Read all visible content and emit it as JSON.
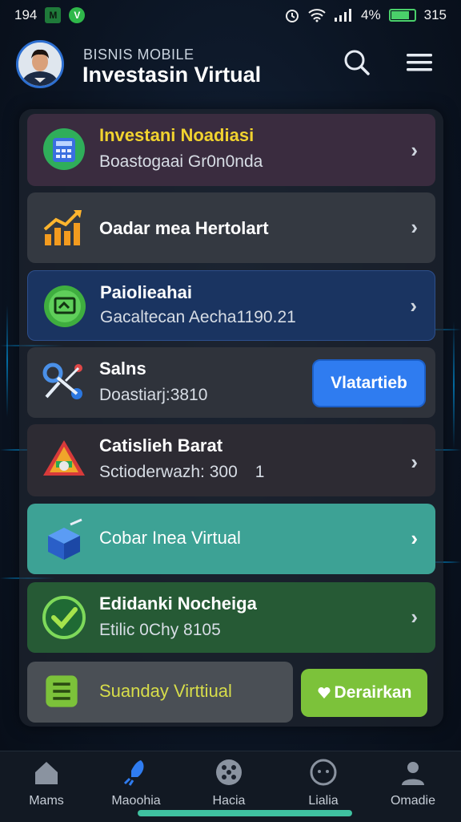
{
  "status_bar": {
    "time": "194",
    "wifi_signal": "4%",
    "battery_text": "315",
    "icons": [
      "m-icon",
      "vpn-icon",
      "alarm-icon",
      "wifi-icon",
      "signal-icon",
      "battery-icon"
    ]
  },
  "header": {
    "subtitle": "BISNIS MOBILE",
    "title": "Investasin Virtual"
  },
  "cards": [
    {
      "title": "Investani Noadiasi",
      "subtitle": "Boastogaai Gr0n0nda",
      "icon": "calculator-icon",
      "color": "#3a2c3f",
      "title_color": "#f1d32f"
    },
    {
      "title": "Oadar mea Hertolart",
      "subtitle": "",
      "icon": "chart-growth-icon",
      "color": "#343941"
    },
    {
      "title": "Paiolieahai",
      "subtitle": "Gacaltecan Aecha1190.21",
      "icon": "monitor-icon",
      "color": "#1a3461"
    },
    {
      "title": "Salns",
      "subtitle": "Doastiarj:3810",
      "icon": "satellite-icon",
      "color": "#2f333b",
      "button": "Vlatartieb"
    },
    {
      "title": "Catislieh Barat",
      "subtitle": "Sctioderwazh: 300",
      "subtitle_suffix": "1",
      "icon": "warning-icon",
      "color": "#2d2b33"
    },
    {
      "title": "Cobar Inea Virtual",
      "subtitle": "",
      "icon": "cube-icon",
      "color": "#3da295"
    },
    {
      "title": "Edidanki Nocheiga",
      "subtitle": "Etilic 0Chy 8105",
      "icon": "check-circle-icon",
      "color": "#265a35"
    },
    {
      "title": "Suanday Virttiual",
      "subtitle": "",
      "icon": "document-icon",
      "color": "#4a4f55",
      "title_color": "#d7dd4a",
      "button": "Derairkan"
    }
  ],
  "buttons": {
    "blue": "Vlatartieb",
    "green": "Derairkan"
  },
  "bottom_nav": [
    {
      "label": "Mams",
      "icon": "home-icon"
    },
    {
      "label": "Maoohia",
      "icon": "rocket-icon"
    },
    {
      "label": "Hacia",
      "icon": "dice-icon"
    },
    {
      "label": "Lialia",
      "icon": "face-icon"
    },
    {
      "label": "Omadie",
      "icon": "user-icon"
    }
  ],
  "colors": {
    "accent_blue": "#2f7cf0",
    "accent_green": "#7cc23a",
    "home_indicator": "#3fc1a0"
  }
}
